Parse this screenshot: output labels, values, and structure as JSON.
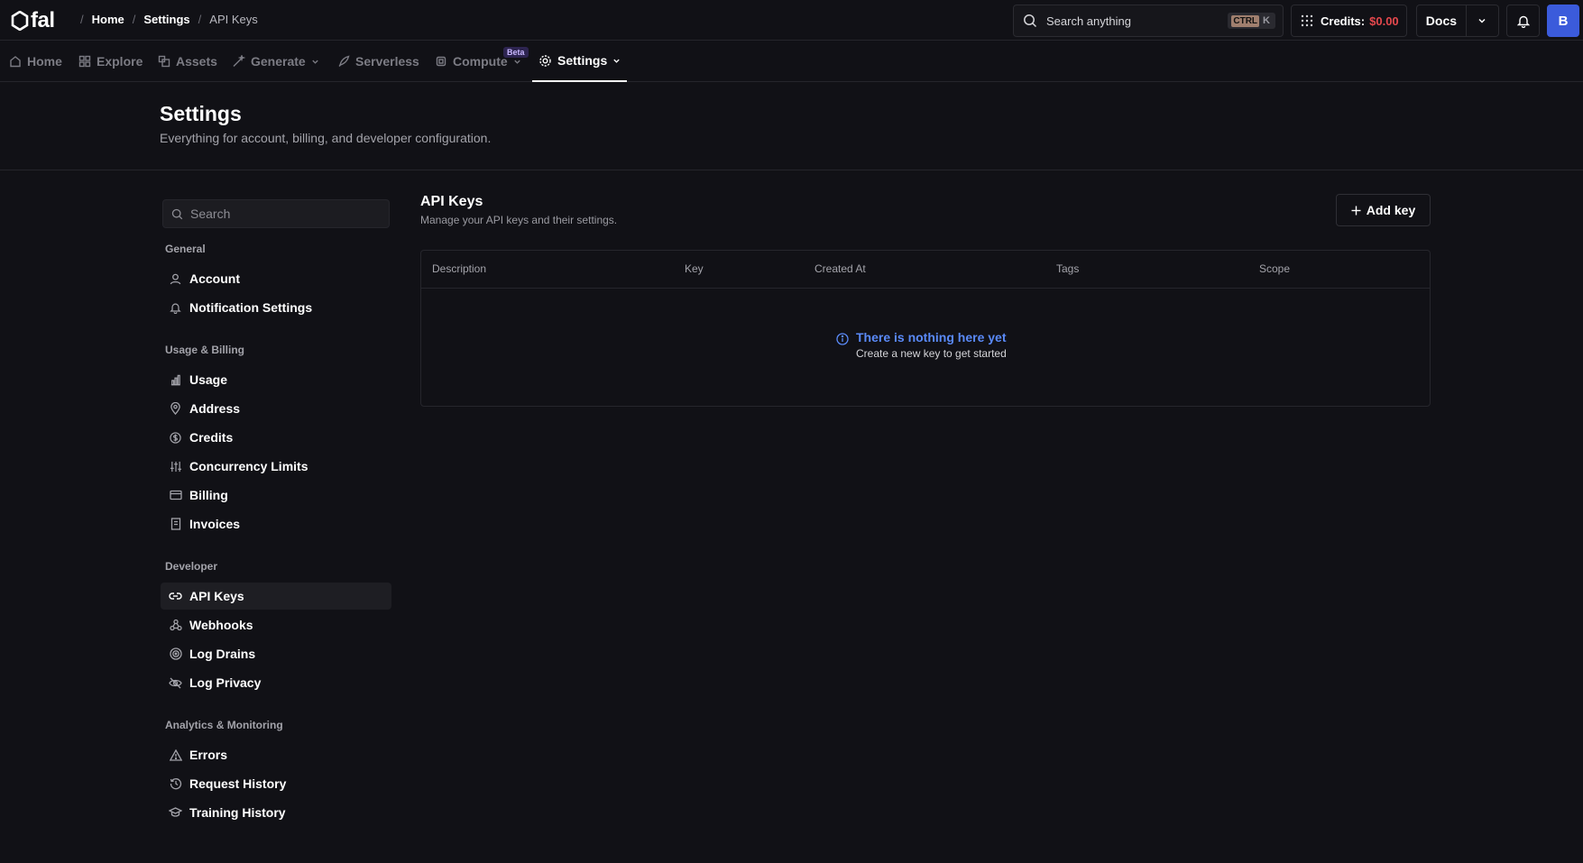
{
  "app": {
    "logo_text": "fal"
  },
  "breadcrumb": [
    {
      "label": "Home"
    },
    {
      "label": "Settings"
    },
    {
      "label": "API Keys"
    }
  ],
  "search": {
    "placeholder": "Search anything",
    "shortcut_key1": "CTRL",
    "shortcut_key2": "K"
  },
  "credits": {
    "label": "Credits:",
    "value": "$0.00"
  },
  "docs": {
    "label": "Docs"
  },
  "user": {
    "avatar_initial": "B"
  },
  "nav": {
    "items": [
      {
        "label": "Home"
      },
      {
        "label": "Explore"
      },
      {
        "label": "Assets"
      },
      {
        "label": "Generate"
      },
      {
        "label": "Serverless"
      },
      {
        "label": "Compute"
      },
      {
        "label": "Settings"
      }
    ],
    "beta_badge": "Beta",
    "active": "Settings"
  },
  "header": {
    "title": "Settings",
    "subtitle": "Everything for account, billing, and developer configuration."
  },
  "sidebar": {
    "search_placeholder": "Search",
    "groups": [
      {
        "label": "General",
        "items": [
          {
            "label": "Account"
          },
          {
            "label": "Notification Settings"
          }
        ]
      },
      {
        "label": "Usage & Billing",
        "items": [
          {
            "label": "Usage"
          },
          {
            "label": "Address"
          },
          {
            "label": "Credits"
          },
          {
            "label": "Concurrency Limits"
          },
          {
            "label": "Billing"
          },
          {
            "label": "Invoices"
          }
        ]
      },
      {
        "label": "Developer",
        "items": [
          {
            "label": "API Keys"
          },
          {
            "label": "Webhooks"
          },
          {
            "label": "Log Drains"
          },
          {
            "label": "Log Privacy"
          }
        ]
      },
      {
        "label": "Analytics & Monitoring",
        "items": [
          {
            "label": "Errors"
          },
          {
            "label": "Request History"
          },
          {
            "label": "Training History"
          }
        ]
      }
    ],
    "active": "API Keys"
  },
  "main": {
    "title": "API Keys",
    "subtitle": "Manage your API keys and their settings.",
    "add_button": "Add key",
    "table": {
      "columns": [
        "Description",
        "Key",
        "Created At",
        "Tags",
        "Scope"
      ],
      "rows": [],
      "empty_title": "There is nothing here yet",
      "empty_subtitle": "Create a new key to get started"
    }
  },
  "colors": {
    "background": "#111116",
    "accent_blue": "#5a8af8",
    "credits_red": "#e5484d",
    "avatar_bg": "#3b5bdb"
  }
}
